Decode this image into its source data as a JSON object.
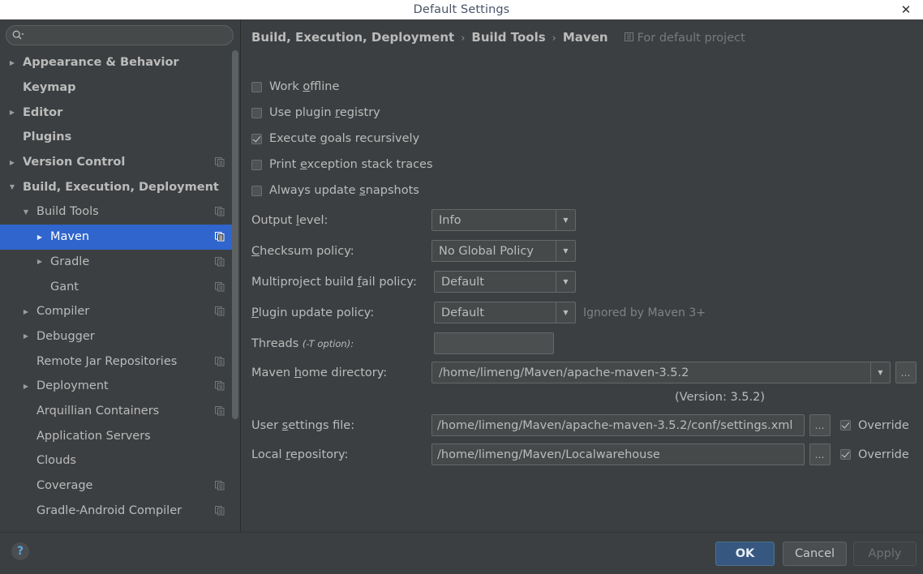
{
  "window": {
    "title": "Default Settings",
    "close_icon": "close-icon"
  },
  "sidebar": {
    "search": {
      "placeholder": "",
      "value": "",
      "icon": "search-icon"
    },
    "items": [
      {
        "label": "Appearance & Behavior",
        "twisty": "collapsed",
        "indent": 0,
        "bold": true,
        "copy": false,
        "selected": false
      },
      {
        "label": "Keymap",
        "twisty": "none",
        "indent": 0,
        "bold": true,
        "copy": false,
        "selected": false
      },
      {
        "label": "Editor",
        "twisty": "collapsed",
        "indent": 0,
        "bold": true,
        "copy": false,
        "selected": false
      },
      {
        "label": "Plugins",
        "twisty": "none",
        "indent": 0,
        "bold": true,
        "copy": false,
        "selected": false
      },
      {
        "label": "Version Control",
        "twisty": "collapsed",
        "indent": 0,
        "bold": true,
        "copy": true,
        "selected": false
      },
      {
        "label": "Build, Execution, Deployment",
        "twisty": "expanded",
        "indent": 0,
        "bold": true,
        "copy": false,
        "selected": false
      },
      {
        "label": "Build Tools",
        "twisty": "expanded",
        "indent": 1,
        "bold": false,
        "copy": true,
        "selected": false
      },
      {
        "label": "Maven",
        "twisty": "collapsed",
        "indent": 2,
        "bold": false,
        "copy": true,
        "selected": true
      },
      {
        "label": "Gradle",
        "twisty": "collapsed",
        "indent": 2,
        "bold": false,
        "copy": true,
        "selected": false
      },
      {
        "label": "Gant",
        "twisty": "none",
        "indent": 2,
        "bold": false,
        "copy": true,
        "selected": false
      },
      {
        "label": "Compiler",
        "twisty": "collapsed",
        "indent": 1,
        "bold": false,
        "copy": true,
        "selected": false
      },
      {
        "label": "Debugger",
        "twisty": "collapsed",
        "indent": 1,
        "bold": false,
        "copy": false,
        "selected": false
      },
      {
        "label": "Remote Jar Repositories",
        "twisty": "none",
        "indent": 1,
        "bold": false,
        "copy": true,
        "selected": false
      },
      {
        "label": "Deployment",
        "twisty": "collapsed",
        "indent": 1,
        "bold": false,
        "copy": true,
        "selected": false
      },
      {
        "label": "Arquillian Containers",
        "twisty": "none",
        "indent": 1,
        "bold": false,
        "copy": true,
        "selected": false
      },
      {
        "label": "Application Servers",
        "twisty": "none",
        "indent": 1,
        "bold": false,
        "copy": false,
        "selected": false
      },
      {
        "label": "Clouds",
        "twisty": "none",
        "indent": 1,
        "bold": false,
        "copy": false,
        "selected": false
      },
      {
        "label": "Coverage",
        "twisty": "none",
        "indent": 1,
        "bold": false,
        "copy": true,
        "selected": false
      },
      {
        "label": "Gradle-Android Compiler",
        "twisty": "none",
        "indent": 1,
        "bold": false,
        "copy": true,
        "selected": false
      }
    ]
  },
  "breadcrumb": {
    "crumb1": "Build, Execution, Deployment",
    "crumb2": "Build Tools",
    "crumb3": "Maven",
    "separator": "›",
    "scope_label": "For default project",
    "scope_icon": "project-scope-icon"
  },
  "main": {
    "checkboxes": [
      {
        "pre": "Work ",
        "mnemonic": "o",
        "post": "ffline",
        "checked": false
      },
      {
        "pre": "Use plugin ",
        "mnemonic": "r",
        "post": "egistry",
        "checked": false
      },
      {
        "pre": "Execute ",
        "mnemonic": "g",
        "post": "oals recursively",
        "checked": true
      },
      {
        "pre": "Print ",
        "mnemonic": "e",
        "post": "xception stack traces",
        "checked": false
      },
      {
        "pre": "Always update ",
        "mnemonic": "s",
        "post": "napshots",
        "checked": false
      }
    ],
    "output_level": {
      "pre": "Output ",
      "mnemonic": "l",
      "post": "evel:",
      "value": "Info"
    },
    "checksum_policy": {
      "pre": "",
      "mnemonic": "C",
      "post": "hecksum policy:",
      "value": "No Global Policy"
    },
    "multiproject_fail_policy": {
      "pre": "Multiproject build ",
      "mnemonic": "f",
      "post": "ail policy:",
      "value": "Default"
    },
    "plugin_update_policy": {
      "pre": "",
      "mnemonic": "P",
      "post": "lugin update policy:",
      "value": "Default",
      "note": "Ignored by Maven 3+"
    },
    "threads": {
      "label": "Threads ",
      "sub": "(-T option):",
      "value": ""
    },
    "maven_home": {
      "pre": "Maven ",
      "mnemonic": "h",
      "post": "ome directory:",
      "value": "/home/limeng/Maven/apache-maven-3.5.2",
      "version_text": "(Version: 3.5.2)",
      "browse_label": "…"
    },
    "user_settings": {
      "pre": "User ",
      "mnemonic": "s",
      "post": "ettings file:",
      "value": "/home/limeng/Maven/apache-maven-3.5.2/conf/settings.xml",
      "browse_label": "…",
      "override_label": "Override",
      "override_checked": true
    },
    "local_repository": {
      "pre": "Local ",
      "mnemonic": "r",
      "post": "epository:",
      "value": "/home/limeng/Maven/Localwarehouse",
      "browse_label": "…",
      "override_label": "Override",
      "override_checked": true
    }
  },
  "footer": {
    "help_label": "?",
    "ok_label": "OK",
    "cancel_label": "Cancel",
    "apply_label": "Apply"
  },
  "colors": {
    "accent_selection": "#2F65CC",
    "panel_bg": "#3C3F41",
    "field_bg": "#45494A",
    "text": "#BBBBBB",
    "ok_button": "#365880",
    "help_icon": "#5BA7DE"
  }
}
